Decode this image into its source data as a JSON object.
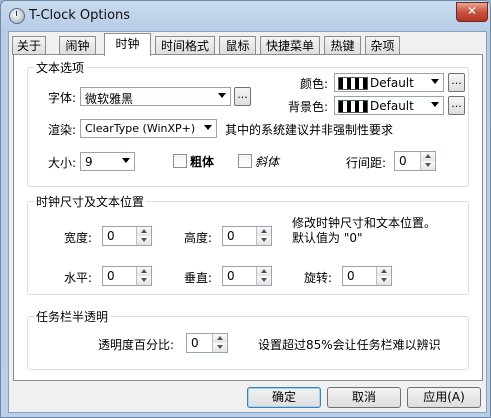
{
  "window": {
    "title": "T-Clock Options",
    "close_label": "✕"
  },
  "tabs": [
    "关于",
    "闹钟",
    "时钟",
    "时间格式",
    "鼠标",
    "快捷菜单",
    "热键",
    "杂项"
  ],
  "text_options": {
    "group_title": "文本选项",
    "font_label": "字体:",
    "font_value": "微软雅黑",
    "browse_label": "...",
    "color_label": "颜色:",
    "color_value": "Default",
    "bgcolor_label": "背景色:",
    "bgcolor_value": "Default",
    "render_label": "渲染:",
    "render_value": "ClearType (WinXP+)",
    "render_note": "其中的系统建议并非强制性要求",
    "size_label": "大小:",
    "size_value": "9",
    "bold_label": "粗体",
    "italic_label": "斜体",
    "line_spacing_label": "行间距:",
    "line_spacing_value": "0"
  },
  "clock_size": {
    "group_title": "时钟尺寸及文本位置",
    "width_label": "宽度:",
    "width_value": "0",
    "height_label": "高度:",
    "height_value": "0",
    "note_line1": "修改时钟尺寸和文本位置。",
    "note_line2": "默认值为 \"0\"",
    "horiz_label": "水平:",
    "horiz_value": "0",
    "vert_label": "垂直:",
    "vert_value": "0",
    "rotate_label": "旋转:",
    "rotate_value": "0"
  },
  "transparency": {
    "group_title": "任务栏半透明",
    "percent_label": "透明度百分比:",
    "percent_value": "0",
    "note": "设置超过85%会让任务栏难以辨识"
  },
  "buttons": {
    "ok": "确定",
    "cancel": "取消",
    "apply": "应用(A)"
  }
}
